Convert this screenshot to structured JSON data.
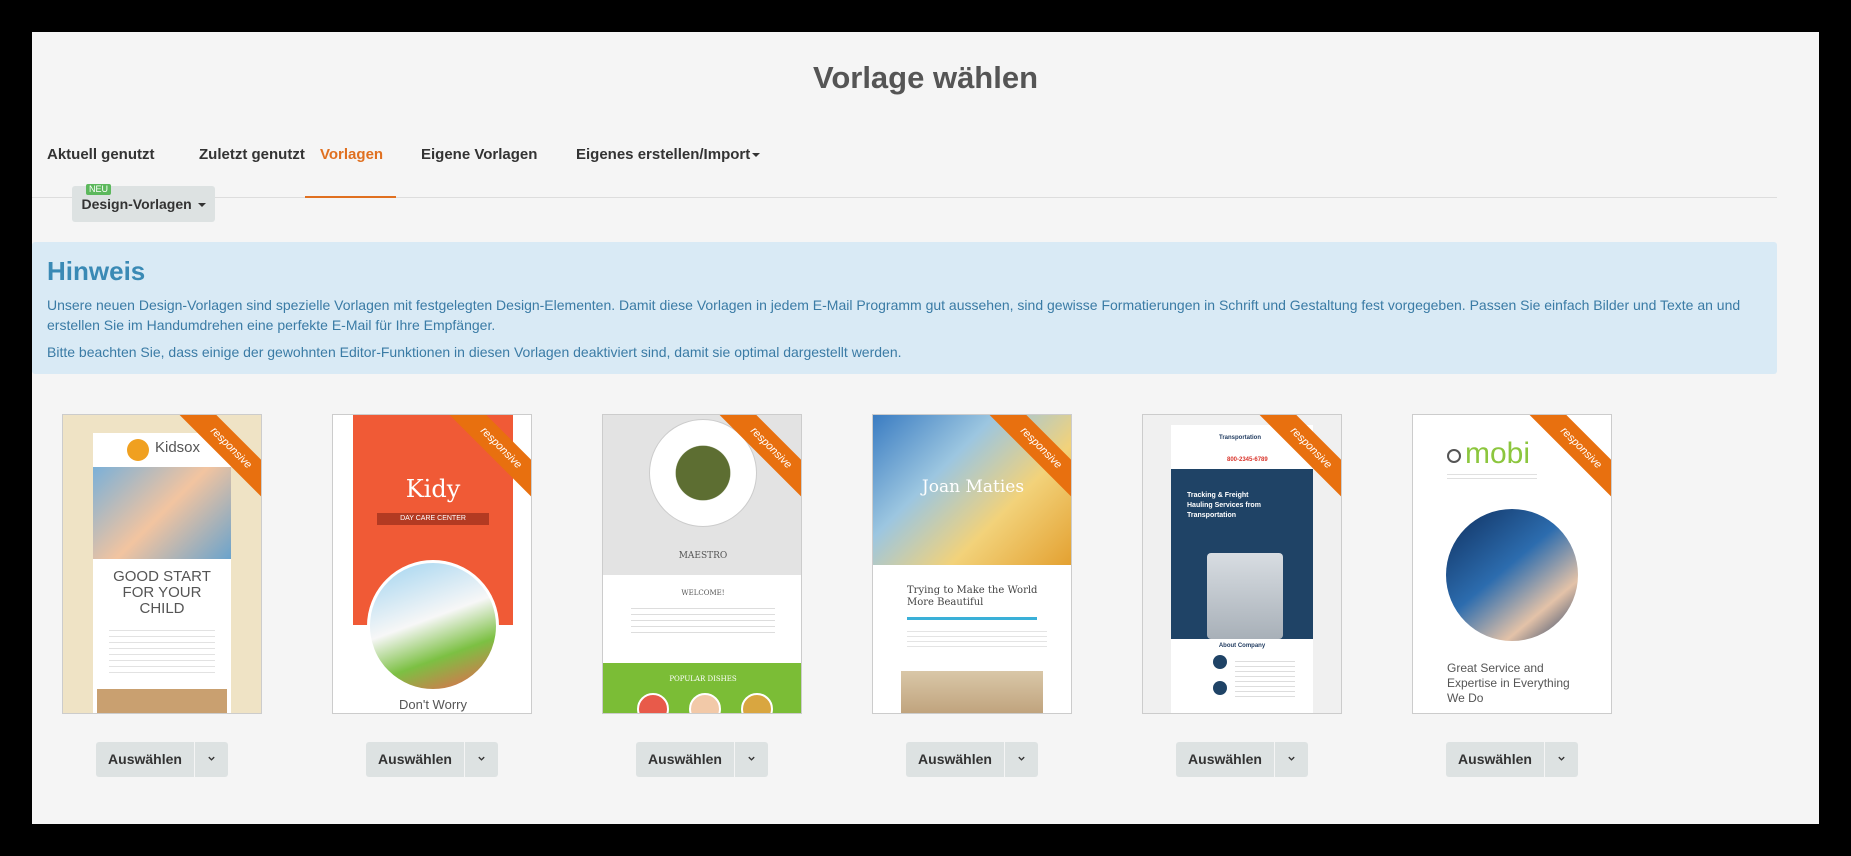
{
  "page": {
    "title": "Vorlage wählen"
  },
  "tabs": [
    {
      "label": "Aktuell genutzt"
    },
    {
      "label": "Zuletzt genutzt"
    },
    {
      "label": "Vorlagen"
    },
    {
      "label": "Eigene Vorlagen"
    },
    {
      "label": "Eigenes erstellen/Import"
    }
  ],
  "active_tab": "Vorlagen",
  "design_dropdown": {
    "badge": "NEU",
    "label": "Design-Vorlagen"
  },
  "notice": {
    "title": "Hinweis",
    "line1": "Unsere neuen Design-Vorlagen sind spezielle Vorlagen mit festgelegten Design-Elementen. Damit diese Vorlagen in jedem E-Mail Programm gut aussehen, sind gewisse Formatierungen in Schrift und Gestaltung fest vorgegeben. Passen Sie einfach Bilder und Texte an und erstellen Sie im Handumdrehen eine perfekte E-Mail für Ihre Empfänger.",
    "line2": "Bitte beachten Sie, dass einige der gewohnten Editor-Funktionen in diesen Vorlagen deaktiviert sind, damit sie optimal dargestellt werden."
  },
  "ribbon_label": "responsive",
  "select_label": "Auswählen",
  "templates": [
    {
      "logo": "Kidsox",
      "headline": "GOOD START FOR YOUR CHILD"
    },
    {
      "logo": "Kidy",
      "subtitle": "DAY CARE CENTER",
      "footer": "Don't Worry"
    },
    {
      "logo": "MAESTRO",
      "welcome": "WELCOME!",
      "section": "POPULAR DISHES"
    },
    {
      "logo": "Joan Maties",
      "headline": "Trying to Make the World More Beautiful"
    },
    {
      "logo": "Transportation",
      "phone": "800-2345-6789",
      "headline": "Tracking & Freight Hauling Services from Transportation",
      "section": "About Company"
    },
    {
      "logo": "mobi",
      "headline": "Great Service and Expertise in Everything We Do"
    }
  ],
  "colors": {
    "accent": "#e07020",
    "notice_bg": "#d9eaf5",
    "notice_text": "#3a7ba5",
    "badge": "#5cb85c",
    "ribbon": "#e8700f"
  }
}
